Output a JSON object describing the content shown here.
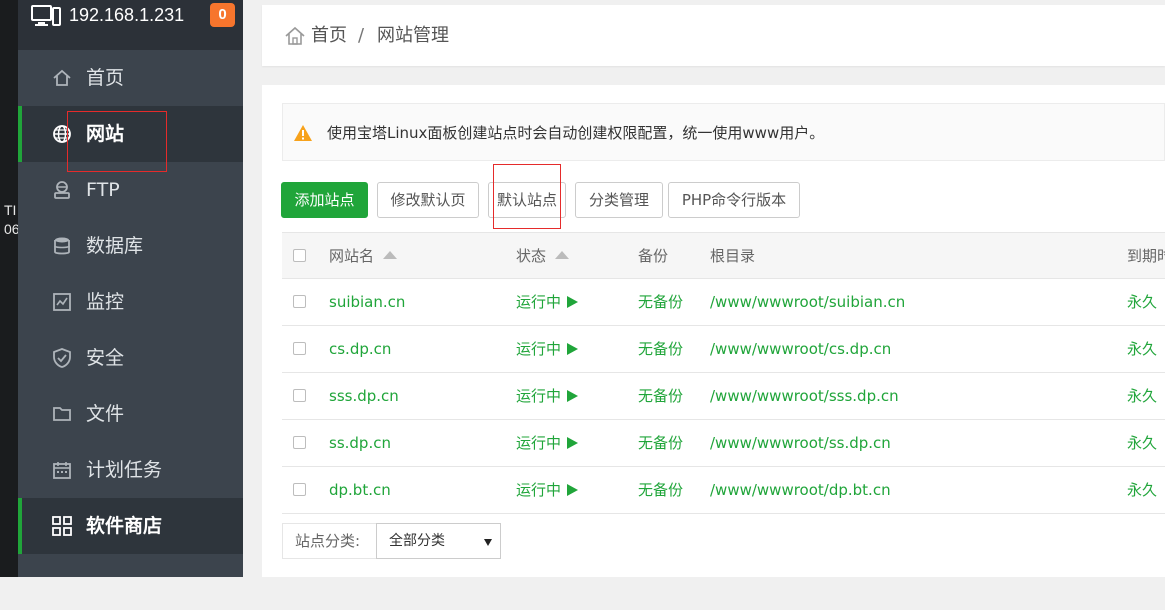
{
  "desktop": {
    "text_line1": "TI",
    "text_line2": "06"
  },
  "sidebar": {
    "ip": "192.168.1.231",
    "badge": "0",
    "items": [
      {
        "label": "首页",
        "icon": "home-icon"
      },
      {
        "label": "网站",
        "icon": "globe-icon"
      },
      {
        "label": "FTP",
        "icon": "ftp-icon"
      },
      {
        "label": "数据库",
        "icon": "database-icon"
      },
      {
        "label": "监控",
        "icon": "monitor-chart-icon"
      },
      {
        "label": "安全",
        "icon": "shield-icon"
      },
      {
        "label": "文件",
        "icon": "folder-icon"
      },
      {
        "label": "计划任务",
        "icon": "calendar-icon"
      },
      {
        "label": "软件商店",
        "icon": "apps-grid-icon"
      }
    ]
  },
  "breadcrumb": {
    "home": "首页",
    "separator": "/",
    "current": "网站管理"
  },
  "notice": {
    "text": "使用宝塔Linux面板创建站点时会自动创建权限配置，统一使用www用户。"
  },
  "toolbar": {
    "add_site": "添加站点",
    "edit_default_page": "修改默认页",
    "default_site": "默认站点",
    "category_manage": "分类管理",
    "php_cli_version": "PHP命令行版本"
  },
  "table": {
    "headers": {
      "name": "网站名",
      "status": "状态",
      "backup": "备份",
      "root": "根目录",
      "expire": "到期时"
    },
    "rows": [
      {
        "name": "suibian.cn",
        "status": "运行中",
        "backup": "无备份",
        "root": "/www/wwwroot/suibian.cn",
        "expire": "永久"
      },
      {
        "name": "cs.dp.cn",
        "status": "运行中",
        "backup": "无备份",
        "root": "/www/wwwroot/cs.dp.cn",
        "expire": "永久"
      },
      {
        "name": "sss.dp.cn",
        "status": "运行中",
        "backup": "无备份",
        "root": "/www/wwwroot/sss.dp.cn",
        "expire": "永久"
      },
      {
        "name": "ss.dp.cn",
        "status": "运行中",
        "backup": "无备份",
        "root": "/www/wwwroot/ss.dp.cn",
        "expire": "永久"
      },
      {
        "name": "dp.bt.cn",
        "status": "运行中",
        "backup": "无备份",
        "root": "/www/wwwroot/dp.bt.cn",
        "expire": "永久"
      }
    ]
  },
  "filter": {
    "label": "站点分类:",
    "selected": "全部分类"
  },
  "colors": {
    "accent": "#20a53a",
    "sidebar": "#3c444d",
    "badge": "#f7752d",
    "highlight": "#e52b2b"
  }
}
